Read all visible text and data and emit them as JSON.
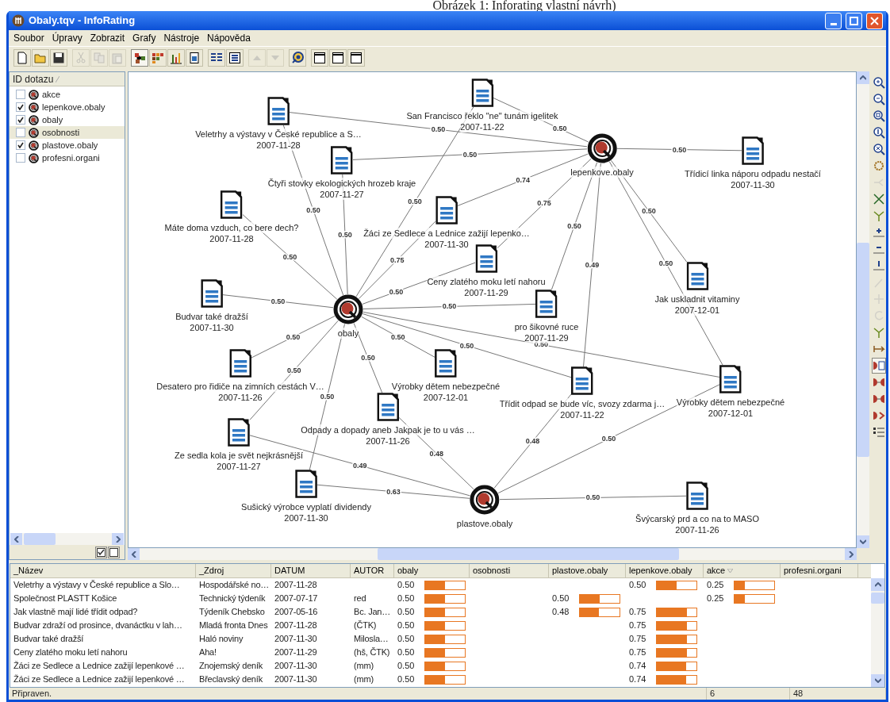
{
  "caption": "Obrázek 1: Inforating vlastní návrh)",
  "window": {
    "title": "Obaly.tqv - InfoRating"
  },
  "menu": [
    "Soubor",
    "Úpravy",
    "Zobrazit",
    "Grafy",
    "Nástroje",
    "Nápověda"
  ],
  "toolbar": {
    "groups": [
      {
        "buttons": [
          {
            "kind": "new",
            "disabled": false,
            "pressed": false
          },
          {
            "kind": "open",
            "disabled": false,
            "pressed": false
          },
          {
            "kind": "save",
            "disabled": false,
            "pressed": false
          }
        ]
      },
      {
        "buttons": [
          {
            "kind": "cut",
            "disabled": true,
            "pressed": false
          },
          {
            "kind": "copy",
            "disabled": true,
            "pressed": false
          },
          {
            "kind": "paste",
            "disabled": true,
            "pressed": false
          }
        ]
      },
      {
        "buttons": [
          {
            "kind": "graph",
            "disabled": false,
            "pressed": true
          },
          {
            "kind": "matrix",
            "disabled": false,
            "pressed": false
          },
          {
            "kind": "bars",
            "disabled": false,
            "pressed": false
          },
          {
            "kind": "page",
            "disabled": false,
            "pressed": false
          }
        ]
      },
      {
        "buttons": [
          {
            "kind": "list",
            "disabled": false,
            "pressed": false
          },
          {
            "kind": "details",
            "disabled": false,
            "pressed": false
          }
        ]
      },
      {
        "buttons": [
          {
            "kind": "up",
            "disabled": true,
            "pressed": false
          },
          {
            "kind": "down",
            "disabled": true,
            "pressed": false
          }
        ]
      },
      {
        "buttons": [
          {
            "kind": "target",
            "disabled": false,
            "pressed": false
          }
        ]
      },
      {
        "buttons": [
          {
            "kind": "layout",
            "disabled": false,
            "pressed": false
          },
          {
            "kind": "layout",
            "disabled": false,
            "pressed": false
          },
          {
            "kind": "layout",
            "disabled": false,
            "pressed": false
          }
        ]
      }
    ]
  },
  "query_panel": {
    "header": "ID dotazu",
    "items": [
      {
        "label": "akce",
        "checked": false,
        "selected": false
      },
      {
        "label": "lepenkove.obaly",
        "checked": true,
        "selected": false
      },
      {
        "label": "obaly",
        "checked": true,
        "selected": false
      },
      {
        "label": "osobnosti",
        "checked": false,
        "selected": true
      },
      {
        "label": "plastove.obaly",
        "checked": true,
        "selected": false
      },
      {
        "label": "profesni.organi",
        "checked": false,
        "selected": false
      }
    ]
  },
  "graph": {
    "queries": [
      {
        "label": "obaly"
      },
      {
        "label": "lepenkove.obaly"
      },
      {
        "label": "plastove.obaly"
      }
    ],
    "documents": [
      {
        "title": "Veletrhy a výstavy v České republice a S…",
        "date": "2007-11-28",
        "weight_q1": "0.50",
        "weight_q2": "0.50"
      },
      {
        "title": "San Francisco řeklo \"ne\" tunám igelitek",
        "date": "2007-11-22",
        "weight_q1": "0.50",
        "weight_q2": "0.50"
      },
      {
        "title": "Čtyři stovky ekologických hrozeb kraje",
        "date": "2007-11-27",
        "weight_q1": "0.50",
        "weight_q2": "0.50"
      },
      {
        "title": "Máte doma vzduch, co bere dech?",
        "date": "2007-11-28",
        "weight_q1": "0.50"
      },
      {
        "title": "Žáci ze Sedlece a Lednice zažijí lepenko…",
        "date": "2007-11-30",
        "weight_q1": "0.75",
        "weight_q2": "0.74"
      },
      {
        "title": "Ceny zlatého moku letí nahoru",
        "date": "2007-11-29",
        "weight_q1": "0.50",
        "weight_q2": "0.75"
      },
      {
        "title": "Budvar také dražší",
        "date": "2007-11-30",
        "weight_q1": "0.50"
      },
      {
        "title": "pro šikovné ruce",
        "date": "2007-11-29",
        "weight_q1": "0.50",
        "weight_q2": "0.50"
      },
      {
        "title": "Třídicí linka náporu odpadu nestačí",
        "date": "2007-11-30",
        "weight_q2": "0.50"
      },
      {
        "title": "Jak uskladnit vitaminy",
        "date": "2007-12-01",
        "weight_q2": "0.50"
      },
      {
        "title": "Desatero pro řidiče na zimních cestách V…",
        "date": "2007-11-26",
        "weight_q1": "0.50"
      },
      {
        "title": "Výrobky dětem nebezpečné",
        "date": "2007-12-01",
        "weight_q1": "0.50"
      },
      {
        "title": "Třídit odpad se bude víc, svozy zdarma j…",
        "date": "2007-11-22",
        "weight_q1": "0.50",
        "weight_q2": "0.49",
        "weight_q3": "0.48"
      },
      {
        "title": "Výrobky dětem nebezpečné",
        "date": "2007-12-01",
        "weight_q1": "0.50",
        "weight_q2": "0.50",
        "weight_q3": "0.50"
      },
      {
        "title": "Odpady a dopady aneb Jakpak je to u vás …",
        "date": "2007-11-26",
        "weight_q1": "0.50",
        "weight_q3": "0.48"
      },
      {
        "title": "Ze sedla kola je svět nejkrásnější",
        "date": "2007-11-27",
        "weight_q1": "0.50",
        "weight_q3": "0.49"
      },
      {
        "title": "Sušický výrobce vyplatí dividendy",
        "date": "2007-11-30",
        "weight_q1": "0.50",
        "weight_q3": "0.63"
      },
      {
        "title": "Švýcarský prd a co na to MASO",
        "date": "2007-11-26",
        "weight_q3": "0.50"
      }
    ]
  },
  "side_toolbar": [
    {
      "kind": "zoom-in",
      "disabled": false,
      "pressed": false
    },
    {
      "kind": "zoom-out",
      "disabled": false,
      "pressed": false
    },
    {
      "kind": "zoom-rect",
      "disabled": false,
      "pressed": false
    },
    {
      "kind": "zoom-one",
      "disabled": false,
      "pressed": false
    },
    {
      "kind": "zoom-fit",
      "disabled": false,
      "pressed": false
    },
    {
      "kind": "ring",
      "disabled": false,
      "pressed": false
    },
    {
      "kind": "tree",
      "disabled": true,
      "pressed": false
    },
    {
      "kind": "cross",
      "disabled": false,
      "pressed": false
    },
    {
      "kind": "fork",
      "disabled": false,
      "pressed": false
    },
    {
      "kind": "plus",
      "disabled": false,
      "pressed": false
    },
    {
      "kind": "minus",
      "disabled": false,
      "pressed": false
    },
    {
      "kind": "one",
      "disabled": false,
      "pressed": false
    },
    {
      "kind": "pin",
      "disabled": true,
      "pressed": false
    },
    {
      "kind": "move",
      "disabled": true,
      "pressed": false
    },
    {
      "kind": "rotate",
      "disabled": true,
      "pressed": false
    },
    {
      "kind": "fork",
      "disabled": false,
      "pressed": false
    },
    {
      "kind": "link",
      "disabled": false,
      "pressed": false
    },
    {
      "kind": "node-doc",
      "disabled": false,
      "pressed": true
    },
    {
      "kind": "node-node",
      "disabled": false,
      "pressed": false
    },
    {
      "kind": "node-node",
      "disabled": false,
      "pressed": false
    },
    {
      "kind": "node-mix",
      "disabled": false,
      "pressed": false
    },
    {
      "kind": "list",
      "disabled": false,
      "pressed": false
    }
  ],
  "table": {
    "columns": [
      {
        "label": "_Název",
        "sorted": false
      },
      {
        "label": "_Zdroj",
        "sorted": false
      },
      {
        "label": "DATUM",
        "sorted": false
      },
      {
        "label": "AUTOR",
        "sorted": false
      },
      {
        "label": "obaly",
        "sorted": false
      },
      {
        "label": "osobnosti",
        "sorted": false
      },
      {
        "label": "plastove.obaly",
        "sorted": false
      },
      {
        "label": "lepenkove.obaly",
        "sorted": false
      },
      {
        "label": "akce",
        "sorted": true
      },
      {
        "label": "profesni.organi",
        "sorted": false
      }
    ],
    "rows": [
      {
        "name": "Veletrhy a výstavy v České republice a Slo…",
        "source": "Hospodářské no…",
        "date": "2007-11-28",
        "score_1": {
          "value": "0.50",
          "level": 0.5
        },
        "score_4": {
          "value": "0.50",
          "level": 0.5
        },
        "score_5": {
          "value": "0.25",
          "level": 0.25
        }
      },
      {
        "name": "Společnost PLASTT Košice",
        "source": "Technický týdeník",
        "date": "2007-07-17",
        "author": "red",
        "score_1": {
          "value": "0.50",
          "level": 0.5
        },
        "score_3": {
          "value": "0.50",
          "level": 0.5
        },
        "score_5": {
          "value": "0.25",
          "level": 0.25
        }
      },
      {
        "name": "Jak vlastně mají lidé třídit odpad?",
        "source": "Týdeník Chebsko",
        "date": "2007-05-16",
        "author": "Bc. Jan…",
        "score_1": {
          "value": "0.50",
          "level": 0.5
        },
        "score_3": {
          "value": "0.48",
          "level": 0.48
        },
        "score_4": {
          "value": "0.75",
          "level": 0.75
        }
      },
      {
        "name": "Budvar zdraží od prosince, dvanáctku v lah…",
        "source": "Mladá fronta Dnes",
        "date": "2007-11-28",
        "author": "(ČTK)",
        "score_1": {
          "value": "0.50",
          "level": 0.5
        },
        "score_4": {
          "value": "0.75",
          "level": 0.75
        }
      },
      {
        "name": "Budvar také dražší",
        "source": "Haló noviny",
        "date": "2007-11-30",
        "author": "Milosla…",
        "score_1": {
          "value": "0.50",
          "level": 0.5
        },
        "score_4": {
          "value": "0.75",
          "level": 0.75
        }
      },
      {
        "name": "Ceny zlatého moku letí nahoru",
        "source": "Aha!",
        "date": "2007-11-29",
        "author": "(hš, ČTK)",
        "score_1": {
          "value": "0.50",
          "level": 0.5
        },
        "score_4": {
          "value": "0.75",
          "level": 0.75
        }
      },
      {
        "name": "Žáci ze Sedlece a Lednice zažijí lepenkové …",
        "source": "Znojemský deník",
        "date": "2007-11-30",
        "author": "(mm)",
        "score_1": {
          "value": "0.50",
          "level": 0.5
        },
        "score_4": {
          "value": "0.74",
          "level": 0.74
        }
      },
      {
        "name": "Žáci ze Sedlece a Lednice zažijí lepenkové …",
        "source": "Břeclavský deník",
        "date": "2007-11-30",
        "author": "(mm)",
        "score_1": {
          "value": "0.50",
          "level": 0.5
        },
        "score_4": {
          "value": "0.74",
          "level": 0.74
        }
      }
    ]
  },
  "status_bar": [
    "Připraven.",
    "6",
    "48"
  ]
}
